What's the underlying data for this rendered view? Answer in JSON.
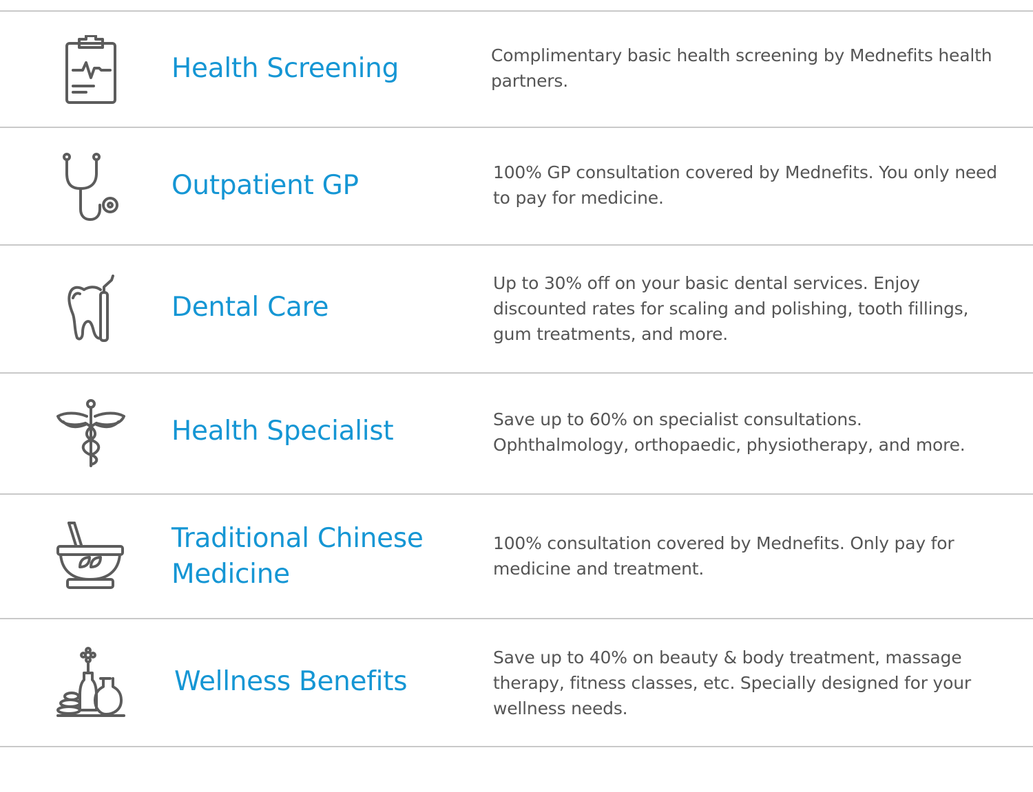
{
  "colors": {
    "title": "#1596d4",
    "text": "#555555",
    "icon": "#5c5c5c",
    "divider": "#c9c9c9"
  },
  "benefits": [
    {
      "icon": "clipboard-heartbeat-icon",
      "title": "Health Screening",
      "description": "Complimentary basic health screening by Mednefits health partners."
    },
    {
      "icon": "stethoscope-icon",
      "title": "Outpatient GP",
      "description": "100% GP consultation covered by Mednefits. You only need to pay for medicine."
    },
    {
      "icon": "tooth-icon",
      "title": "Dental Care",
      "description": "Up to 30% off on your basic dental services. Enjoy discounted rates for scaling and polishing, tooth fillings, gum treatments, and more."
    },
    {
      "icon": "caduceus-icon",
      "title": "Health Specialist",
      "description": "Save up to 60% on specialist consultations. Ophthalmology, orthopaedic, physiotherapy, and more."
    },
    {
      "icon": "mortar-pestle-icon",
      "title": "Traditional Chinese Medicine",
      "description": "100% consultation covered by Mednefits. Only pay for medicine and treatment."
    },
    {
      "icon": "spa-wellness-icon",
      "title": "Wellness Benefits",
      "description": "Save up to 40% on beauty & body treatment, massage therapy, fitness classes, etc. Specially designed for your wellness needs."
    }
  ]
}
